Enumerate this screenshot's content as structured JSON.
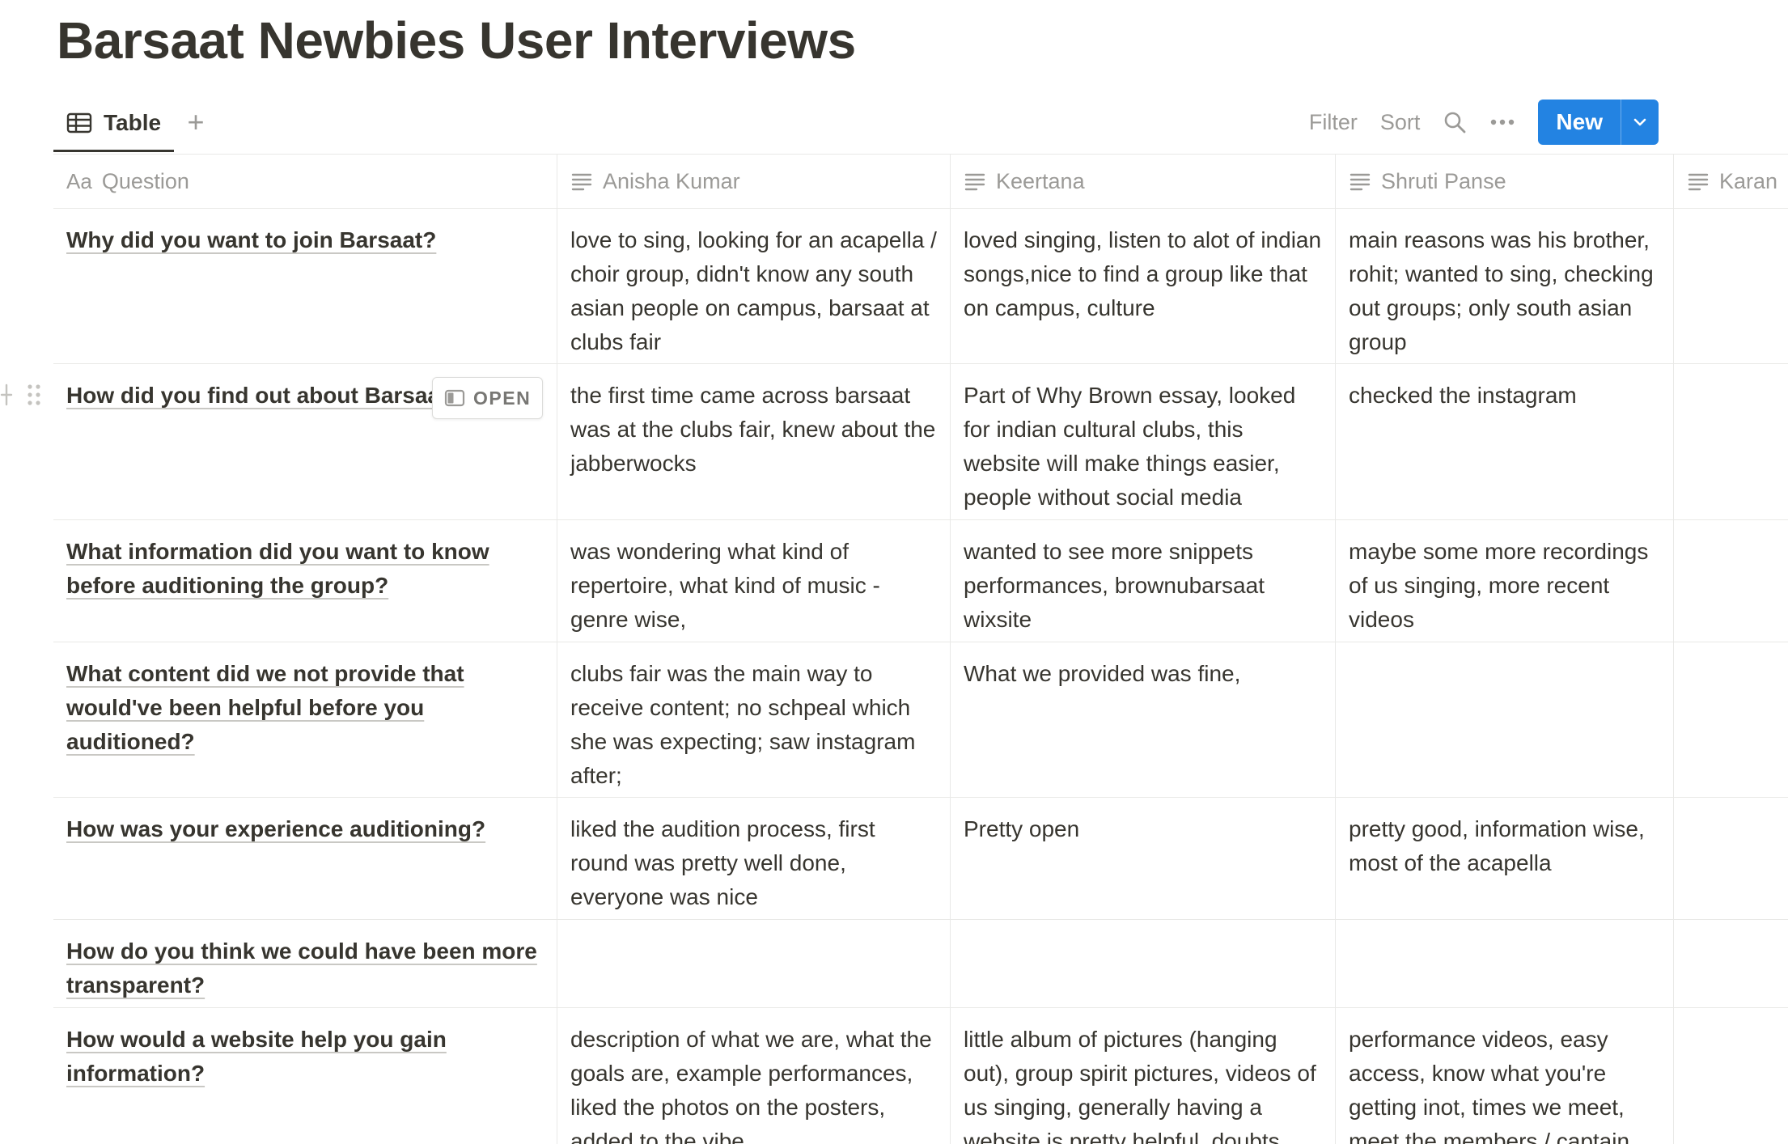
{
  "page": {
    "title": "Barsaat Newbies User Interviews"
  },
  "view_bar": {
    "tab_label": "Table",
    "add_view_label": "+",
    "filter_label": "Filter",
    "sort_label": "Sort",
    "new_label": "New"
  },
  "table": {
    "columns": [
      {
        "icon": "Aa",
        "label": "Question"
      },
      {
        "icon": "text-lines-icon",
        "label": "Anisha Kumar"
      },
      {
        "icon": "text-lines-icon",
        "label": "Keertana"
      },
      {
        "icon": "text-lines-icon",
        "label": "Shruti Panse"
      },
      {
        "icon": "text-lines-icon",
        "label": "Karan"
      }
    ],
    "open_chip_label": "OPEN",
    "rows": [
      {
        "question": "Why did you want to join Barsaat?",
        "anisha": "love to sing, looking for an acapella / choir group, didn't know any south asian people on campus, barsaat at clubs fair",
        "keertana": "loved singing, listen to alot of indian songs,nice to find a group like that on campus, culture",
        "shruti": "main reasons was his brother, rohit; wanted to sing, checking out groups; only south asian group",
        "karan": ""
      },
      {
        "question": "How did you find out about Barsaa",
        "anisha": "the first time came across barsaat was at the clubs fair, knew about the jabberwocks",
        "keertana": "Part of Why Brown essay, looked for indian cultural clubs, this website will make things easier, people without social media",
        "shruti": "checked the instagram",
        "karan": ""
      },
      {
        "question": "What information did you want to know before auditioning the group?",
        "anisha": "was wondering what kind of repertoire, what kind of music - genre wise,",
        "keertana": "wanted to see more snippets performances, brownubarsaat wixsite",
        "shruti": "maybe some more recordings of us singing, more recent videos",
        "karan": ""
      },
      {
        "question": "What content did we not provide that would've been helpful before you auditioned?",
        "anisha": "clubs fair was the main way to receive content; no schpeal which she was expecting; saw instagram after;",
        "keertana": "What we provided was fine,",
        "shruti": "",
        "karan": ""
      },
      {
        "question": "How was your experience auditioning?",
        "anisha": "liked the audition process, first round was pretty well done, everyone was nice",
        "keertana": "Pretty open",
        "shruti": "pretty good, information wise, most of the acapella",
        "karan": ""
      },
      {
        "question": "How do you think we could have been more transparent?",
        "anisha": "",
        "keertana": "",
        "shruti": "",
        "karan": ""
      },
      {
        "question": "How would a website help you gain information?",
        "anisha": "description of what we are, what the goals are, example performances, liked the photos on the posters, added to the vibe",
        "keertana": "little album of pictures (hanging out), group spirit pictures, videos of us singing, generally having a website is pretty helpful, doubts",
        "shruti": "performance videos, easy access, know what you're getting inot, times we meet, meet the members / captain,",
        "karan": ""
      }
    ]
  },
  "colors": {
    "text": "#37352f",
    "muted": "#9b9a97",
    "accent": "#2383e2",
    "border": "#e9e9e7"
  }
}
